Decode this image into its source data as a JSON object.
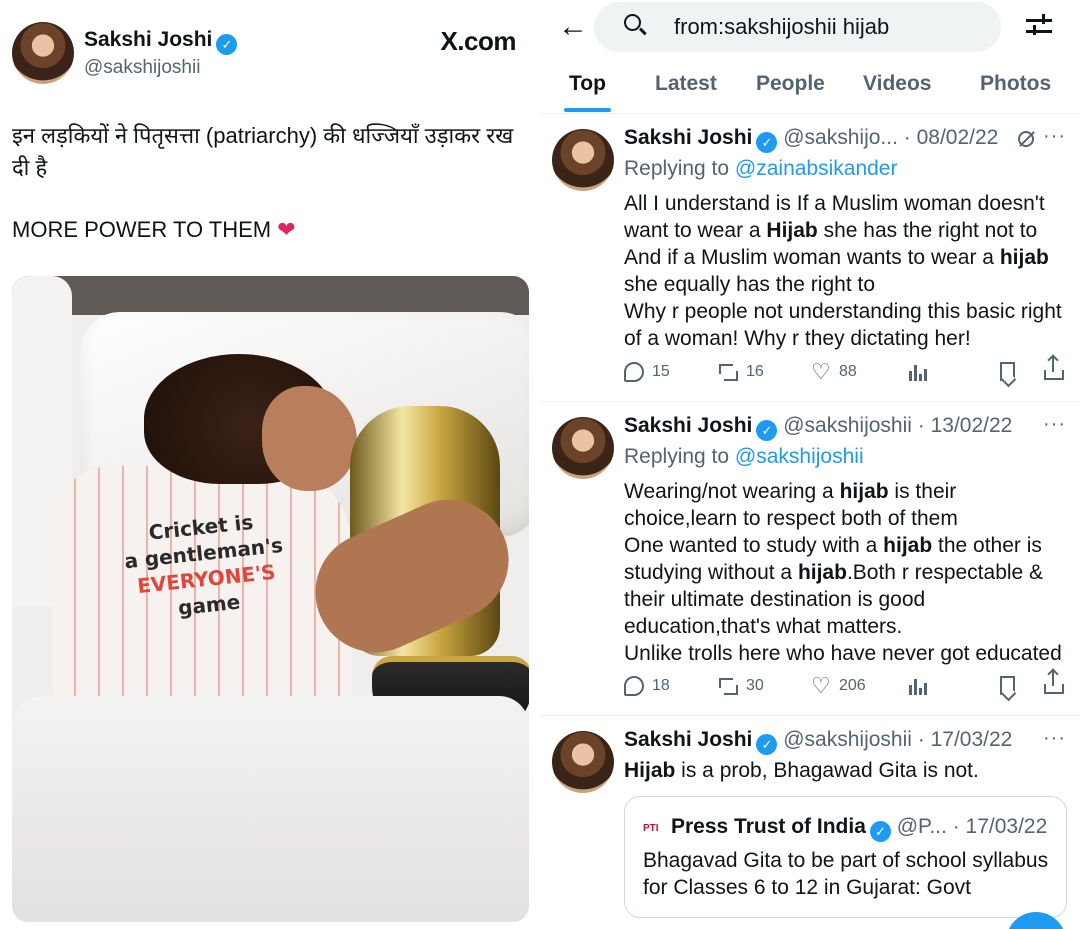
{
  "left_post": {
    "name": "Sakshi Joshi",
    "handle": "@sakshijoshii",
    "brand": "X.com",
    "text_line1": "इन लड़कियों ने पितृसत्ता (patriarchy) की धज्जियाँ उड़ाकर रख दी है",
    "text_line2": "MORE POWER TO THEM",
    "heart": "❤",
    "photo": {
      "shirt_line1": "Cricket is",
      "shirt_line2": "a gentleman's",
      "shirt_line3": "EVERYONE'S",
      "shirt_line4": "game"
    }
  },
  "search": {
    "query": "from:sakshijoshii hijab"
  },
  "tabs": [
    {
      "label": "Top"
    },
    {
      "label": "Latest"
    },
    {
      "label": "People"
    },
    {
      "label": "Videos"
    },
    {
      "label": "Photos"
    }
  ],
  "tweets": [
    {
      "name": "Sakshi Joshi",
      "meta": "@sakshijo... · 08/02/22",
      "replying_prefix": "Replying to ",
      "replying_to": "@zainabsikander",
      "lines": [
        [
          "All I understand is If a Muslim woman doesn't"
        ],
        [
          "want to wear a ",
          {
            "b": "Hijab"
          },
          " she has the right not to"
        ],
        [
          "And if a Muslim woman wants to wear a ",
          {
            "b": "hijab"
          }
        ],
        [
          "she equally has the right to"
        ],
        [
          "Why r people not understanding this basic right"
        ],
        [
          "of a woman! Why r they dictating her!"
        ]
      ],
      "replies": "15",
      "reposts": "16",
      "likes": "88"
    },
    {
      "name": "Sakshi Joshi",
      "meta": "@sakshijoshii · 13/02/22",
      "replying_prefix": "Replying to ",
      "replying_to": "@sakshijoshii",
      "lines": [
        [
          "Wearing/not wearing a ",
          {
            "b": "hijab"
          },
          " is their"
        ],
        [
          "choice,learn to respect both of them"
        ],
        [
          "One wanted to study with a ",
          {
            "b": "hijab"
          },
          " the other is"
        ],
        [
          "studying without a ",
          {
            "b": "hijab"
          },
          ".Both r respectable &"
        ],
        [
          "their ultimate destination is good"
        ],
        [
          "education,that's what matters."
        ],
        [
          "Unlike trolls here who have never got educated"
        ]
      ],
      "replies": "18",
      "reposts": "30",
      "likes": "206"
    },
    {
      "name": "Sakshi Joshi",
      "meta": "@sakshijoshii · 17/03/22",
      "lines": [
        [
          {
            "b": "Hijab"
          },
          " is a prob, Bhagawad Gita is not."
        ]
      ],
      "quote": {
        "logo": "PTI",
        "name": "Press Trust of India",
        "meta": "@P... · 17/03/22",
        "text_line1": "Bhagavad Gita to be part of school syllabus",
        "text_line2": "for Classes 6 to 12 in Gujarat: Govt"
      }
    }
  ],
  "colors": {
    "accent": "#1d9bf0",
    "text": "#0f1419",
    "muted": "#536471",
    "heart": "#e0245e"
  },
  "icons": [
    "back-arrow-icon",
    "search-icon",
    "filter-icon",
    "verified-icon",
    "reply-icon",
    "repost-icon",
    "like-icon",
    "views-icon",
    "bookmark-icon",
    "share-icon",
    "more-icon",
    "grok-icon"
  ]
}
